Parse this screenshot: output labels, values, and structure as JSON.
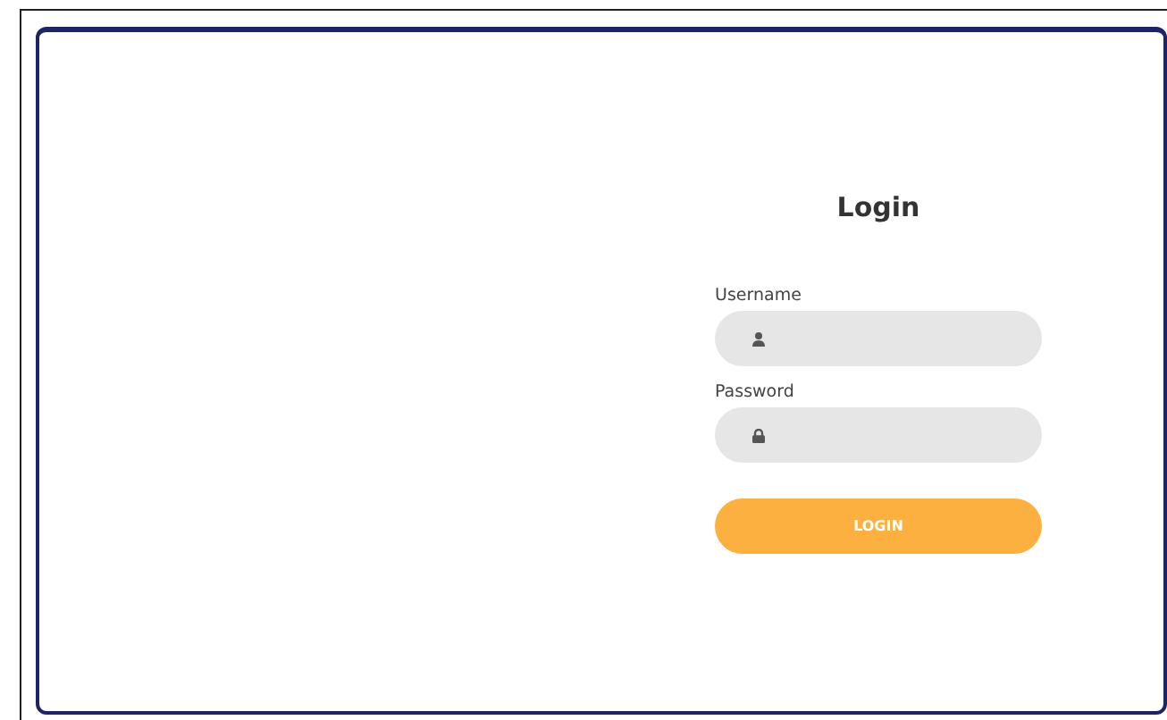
{
  "title": "Login",
  "fields": [
    {
      "label": "Username",
      "kind": "user"
    },
    {
      "label": "Password",
      "kind": "lock"
    }
  ],
  "button": "LOGIN"
}
